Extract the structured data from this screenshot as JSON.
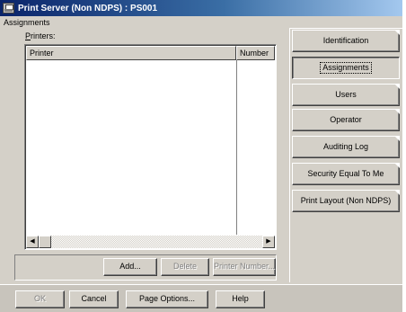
{
  "window": {
    "title": "Print Server (Non NDPS) : PS001"
  },
  "section": {
    "label": "Assignments"
  },
  "printers": {
    "label_access": "P",
    "label_rest": "rinters:",
    "columns": {
      "printer": "Printer",
      "number": "Number"
    }
  },
  "scroll": {
    "left_arrow": "◀",
    "right_arrow": "▶"
  },
  "list_buttons": {
    "add": "Add...",
    "delete": "Delete",
    "printer_number": "Printer Number..."
  },
  "footer": {
    "ok": "OK",
    "cancel": "Cancel",
    "page_options": "Page Options...",
    "help": "Help"
  },
  "tabs": [
    {
      "label": "Identification",
      "selected": false
    },
    {
      "label": "Assignments",
      "selected": true
    },
    {
      "label": "Users",
      "selected": false
    },
    {
      "label": "Operator",
      "selected": false
    },
    {
      "label": "Auditing Log",
      "selected": false
    },
    {
      "label": "Security Equal To Me",
      "selected": false
    },
    {
      "label": "Print Layout (Non NDPS)",
      "selected": false
    }
  ]
}
